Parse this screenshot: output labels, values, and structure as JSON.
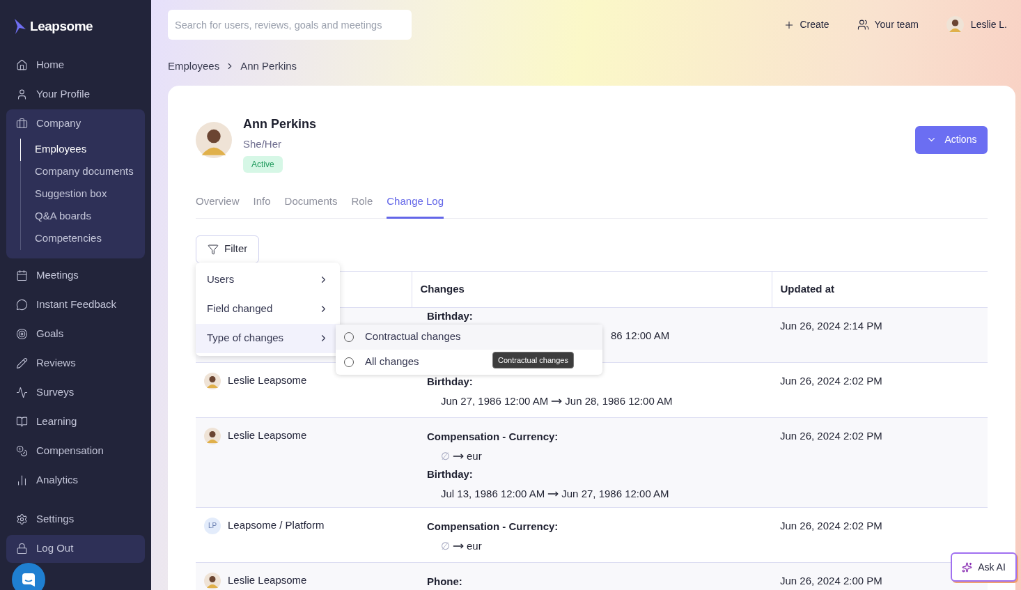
{
  "logo": "Leapsome",
  "sidebar": {
    "items": [
      {
        "label": "Home",
        "highlighted": false
      },
      {
        "label": "Your Profile",
        "highlighted": false
      },
      {
        "label": "Company",
        "highlighted": true,
        "expanded": true,
        "children": [
          {
            "label": "Employees",
            "selected": true
          },
          {
            "label": "Company documents",
            "selected": false
          },
          {
            "label": "Suggestion box",
            "selected": false
          },
          {
            "label": "Q&A boards",
            "selected": false
          },
          {
            "label": "Competencies",
            "selected": false
          }
        ]
      },
      {
        "label": "Meetings",
        "highlighted": false
      },
      {
        "label": "Instant Feedback",
        "highlighted": false
      },
      {
        "label": "Goals",
        "highlighted": false
      },
      {
        "label": "Reviews",
        "highlighted": false
      },
      {
        "label": "Surveys",
        "highlighted": false
      },
      {
        "label": "Learning",
        "highlighted": false
      },
      {
        "label": "Compensation",
        "highlighted": false
      },
      {
        "label": "Analytics",
        "highlighted": false
      }
    ],
    "bottom_items": [
      {
        "label": "Settings",
        "highlighted": false
      },
      {
        "label": "Log Out",
        "highlighted": true
      }
    ]
  },
  "search": {
    "placeholder": "Search for users, reviews, goals and meetings"
  },
  "top_actions": [
    "Create",
    "Your team"
  ],
  "user_menu": "Leslie L.",
  "breadcrumb": [
    "Employees",
    "Ann Perkins"
  ],
  "employee": {
    "name": "Ann Perkins",
    "pronouns": "She/Her",
    "status": "Active"
  },
  "actions_button": "Actions",
  "tabs": [
    {
      "label": "Overview",
      "selected": false
    },
    {
      "label": "Info",
      "selected": false
    },
    {
      "label": "Documents",
      "selected": false
    },
    {
      "label": "Role",
      "selected": false
    },
    {
      "label": "Change Log",
      "selected": true
    }
  ],
  "filter_button": "Filter",
  "filter_menu": [
    {
      "label": "Users",
      "selected": false
    },
    {
      "label": "Field changed",
      "selected": false
    },
    {
      "label": "Type of changes",
      "selected": true
    }
  ],
  "submenu": [
    {
      "label": "Contractual changes",
      "checked": false,
      "hovered": true
    },
    {
      "label": "All changes",
      "checked": false,
      "hovered": false
    }
  ],
  "tooltip": "Contractual changes",
  "table": {
    "columns": [
      "Changes",
      "Updated at"
    ],
    "rows": [
      {
        "changes": [
          {
            "label": "Birthday:",
            "kind": "clipped",
            "text": "86 12:00 AM"
          }
        ],
        "updated": "Jun 26, 2024 2:14 PM"
      },
      {
        "user": {
          "name": "Leslie Leapsome",
          "kind": "photo"
        },
        "changes": [
          {
            "label": "Birthday:",
            "kind": "change",
            "from": "Jun 27, 1986 12:00 AM",
            "to": "Jun 28, 1986 12:00 AM",
            "from_empty": false
          }
        ],
        "updated": "Jun 26, 2024 2:02 PM"
      },
      {
        "user": {
          "name": "Leslie Leapsome",
          "kind": "photo"
        },
        "changes": [
          {
            "label": "Compensation - Currency:",
            "kind": "change",
            "from": "∅",
            "to": "eur",
            "from_empty": true
          },
          {
            "label": "Birthday:",
            "kind": "change",
            "from": "Jul 13, 1986 12:00 AM",
            "to": "Jun 27, 1986 12:00 AM",
            "from_empty": false
          }
        ],
        "updated": "Jun 26, 2024 2:02 PM"
      },
      {
        "user": {
          "name": "Leapsome / Platform",
          "kind": "initials",
          "initials": "LP"
        },
        "changes": [
          {
            "label": "Compensation - Currency:",
            "kind": "change",
            "from": "∅",
            "to": "eur",
            "from_empty": true
          }
        ],
        "updated": "Jun 26, 2024 2:02 PM"
      },
      {
        "user": {
          "name": "Leslie Leapsome",
          "kind": "photo"
        },
        "changes": [
          {
            "label": "Phone:",
            "kind": "label"
          }
        ],
        "updated": "Jun 26, 2024 2:00 PM"
      }
    ]
  },
  "ask_ai": "Ask AI"
}
